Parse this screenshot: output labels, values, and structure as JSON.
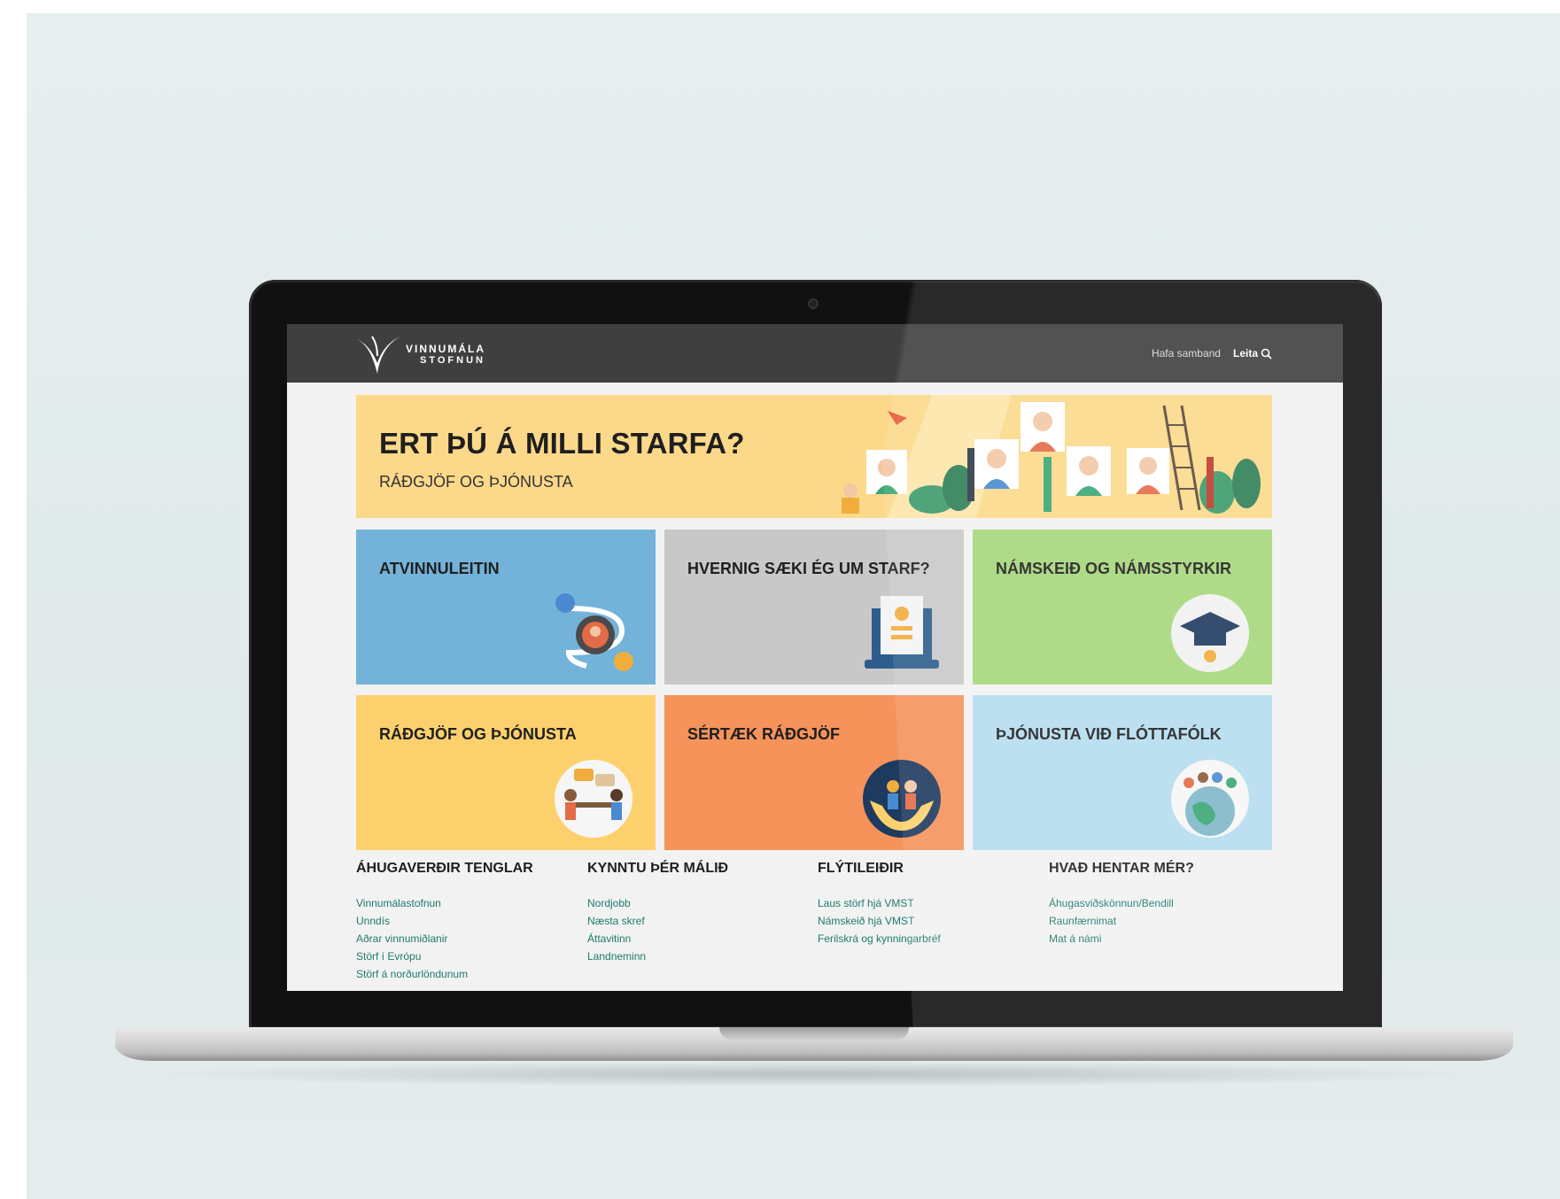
{
  "colors": {
    "header_bg": "#3f3f3f",
    "hero_bg": "#fcd98a",
    "link": "#1e7a6c"
  },
  "header": {
    "logo_line1": "VINNUMÁLA",
    "logo_line2": "STOFNUN",
    "contact_label": "Hafa samband",
    "search_label": "Leita",
    "search_icon": "search-icon"
  },
  "hero": {
    "title": "ERT ÞÚ Á MILLI STARFA?",
    "subtitle": "RÁÐGJÖF OG ÞJÓNUSTA"
  },
  "tiles": [
    {
      "title": "ATVINNULEITIN",
      "color": "#74b3d9",
      "icon": "job-search-icon"
    },
    {
      "title": "HVERNIG SÆKI ÉG UM STARF?",
      "color": "#c8c8c8",
      "icon": "laptop-cv-icon"
    },
    {
      "title": "NÁMSKEIÐ OG NÁMSSTYRKIR",
      "color": "#a6d77c",
      "icon": "graduation-cap-icon"
    },
    {
      "title": "RÁÐGJÖF OG ÞJÓNUSTA",
      "color": "#fcd16d",
      "icon": "counselling-icon"
    },
    {
      "title": "SÉRTÆK RÁÐGJÖF",
      "color": "#f5935a",
      "icon": "caring-hands-icon"
    },
    {
      "title": "ÞJÓNUSTA VIÐ FLÓTTAFÓLK",
      "color": "#b5dcef",
      "icon": "globe-people-icon"
    }
  ],
  "footer": {
    "columns": [
      {
        "title": "ÁHUGAVERÐIR TENGLAR",
        "links": [
          "Vinnumálastofnun",
          "Unndís",
          "Aðrar vinnumiðlanir",
          "Störf í Evrópu",
          "Störf á norðurlöndunum"
        ]
      },
      {
        "title": "KYNNTU ÞÉR MÁLIÐ",
        "links": [
          "Nordjobb",
          "Næsta skref",
          "Áttavitinn",
          "Landneminn"
        ]
      },
      {
        "title": "FLÝTILEIÐIR",
        "links": [
          "Laus störf hjá VMST",
          "Námskeið hjá VMST",
          "Ferilskrá og kynningarbréf"
        ]
      },
      {
        "title": "HVAÐ HENTAR MÉR?",
        "links": [
          "Áhugasviðskönnun/Bendill",
          "Raunfærnimat",
          "Mat á námi"
        ]
      }
    ]
  }
}
